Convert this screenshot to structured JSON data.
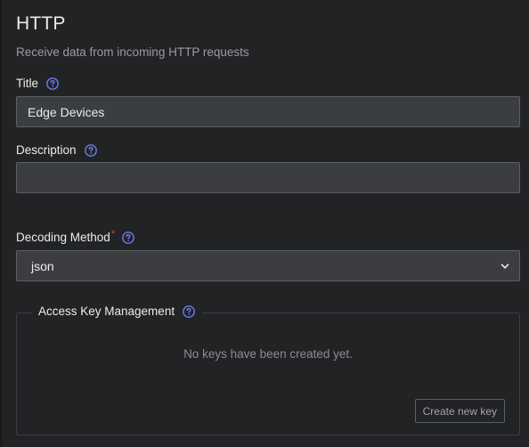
{
  "header": {
    "title": "HTTP",
    "subtitle": "Receive data from incoming HTTP requests"
  },
  "fields": {
    "title": {
      "label": "Title",
      "value": "Edge Devices",
      "help_icon": "question-circle-icon"
    },
    "description": {
      "label": "Description",
      "value": "",
      "help_icon": "question-circle-icon"
    },
    "decoding_method": {
      "label": "Decoding Method",
      "required_marker": "*",
      "value": "json",
      "help_icon": "question-circle-icon"
    }
  },
  "access_keys": {
    "legend": "Access Key Management",
    "empty_message": "No keys have been created yet.",
    "create_button_label": "Create new key",
    "help_icon": "question-circle-icon"
  },
  "colors": {
    "background": "#222325",
    "input_background": "#3b3d40",
    "help_icon": "#6f7cf2",
    "required": "#e0424b"
  }
}
